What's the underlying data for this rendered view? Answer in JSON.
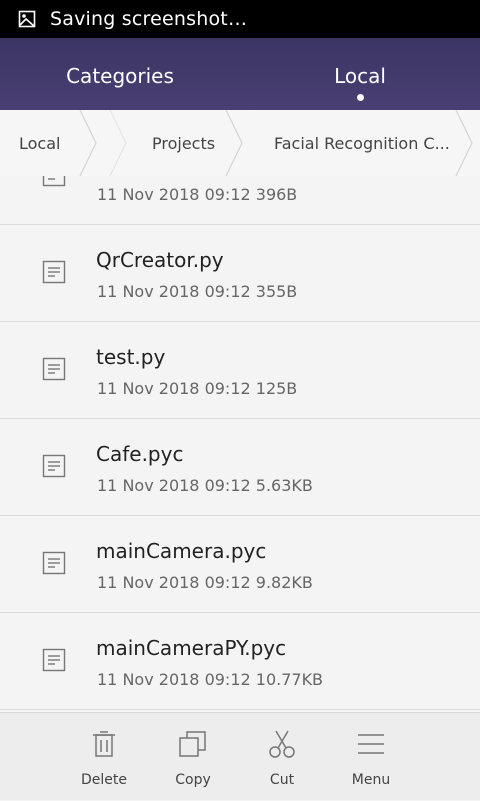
{
  "status_bar": {
    "text": "Saving screenshot…",
    "icon": "image-icon"
  },
  "tabs": [
    {
      "label": "Categories",
      "active": false
    },
    {
      "label": "Local",
      "active": true
    }
  ],
  "breadcrumb": [
    "Local",
    "Projects",
    "Facial Recognition C..."
  ],
  "files": [
    {
      "name": "",
      "meta": "11 Nov 2018 09:12 396B",
      "icon": "document-icon"
    },
    {
      "name": "QrCreator.py",
      "meta": "11 Nov 2018 09:12 355B",
      "icon": "document-icon"
    },
    {
      "name": "test.py",
      "meta": "11 Nov 2018 09:12 125B",
      "icon": "document-icon"
    },
    {
      "name": "Cafe.pyc",
      "meta": "11 Nov 2018 09:12 5.63KB",
      "icon": "document-icon"
    },
    {
      "name": "mainCamera.pyc",
      "meta": "11 Nov 2018 09:12 9.82KB",
      "icon": "document-icon"
    },
    {
      "name": "mainCameraPY.pyc",
      "meta": "11 Nov 2018 09:12 10.77KB",
      "icon": "document-icon"
    }
  ],
  "toolbar": {
    "delete": "Delete",
    "copy": "Copy",
    "cut": "Cut",
    "menu": "Menu"
  },
  "colors": {
    "tabs_bg_top": "#3b3564",
    "tabs_bg_bottom": "#4a3f73",
    "list_bg": "#f4f4f4",
    "toolbar_bg": "#ededed"
  }
}
